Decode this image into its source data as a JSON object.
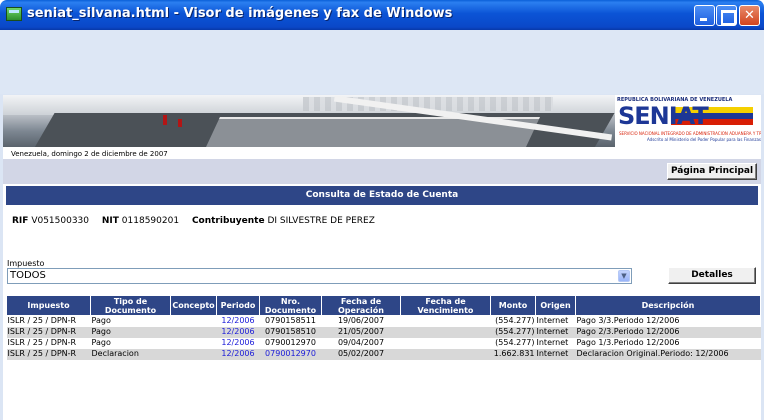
{
  "window": {
    "title": "seniat_silvana.html - Visor de imágenes y fax de Windows",
    "app_icon": "image-viewer-icon"
  },
  "banner": {
    "logo_top": "REPUBLICA BOLIVARIANA DE VENEZUELA",
    "logo_text": "SENIAT",
    "logo_sub": "SERVICIO NACIONAL INTEGRADO DE ADMINISTRACION ADUANERA Y TRIBUTARIA",
    "logo_sub2": "Adscrito al Ministerio del Poder Popular para las Finanzas",
    "date_line": "Venezuela, domingo 2 de diciembre de 2007"
  },
  "nav": {
    "home_button": "Página Principal"
  },
  "section": {
    "title": "Consulta de Estado de Cuenta"
  },
  "taxpayer": {
    "rif_label": "RIF",
    "rif_value": "V051500330",
    "nit_label": "NIT",
    "nit_value": "0118590201",
    "contrib_label": "Contribuyente",
    "contrib_value": "DI SILVESTRE DE PEREZ"
  },
  "filter": {
    "label": "Impuesto",
    "selected": "TODOS",
    "details_button": "Detalles"
  },
  "table": {
    "headers": [
      "Impuesto",
      "Tipo de Documento",
      "Concepto",
      "Periodo",
      "Nro. Documento",
      "Fecha de Operación",
      "Fecha de Vencimiento",
      "Monto",
      "Origen",
      "Descripción"
    ],
    "rows": [
      [
        "ISLR / 25 / DPN-R",
        "Pago",
        "",
        "12/2006",
        "0790158511",
        "19/06/2007",
        "",
        "(554.277)",
        "Internet",
        "Pago 3/3.Periodo 12/2006"
      ],
      [
        "ISLR / 25 / DPN-R",
        "Pago",
        "",
        "12/2006",
        "0790158510",
        "21/05/2007",
        "",
        "(554.277)",
        "Internet",
        "Pago 2/3.Periodo 12/2006"
      ],
      [
        "ISLR / 25 / DPN-R",
        "Pago",
        "",
        "12/2006",
        "0790012970",
        "09/04/2007",
        "",
        "(554.277)",
        "Internet",
        "Pago 1/3.Periodo 12/2006"
      ],
      [
        "ISLR / 25 / DPN-R",
        "Declaracion",
        "",
        "12/2006",
        "0790012970",
        "05/02/2007",
        "",
        "1.662.831",
        "Internet",
        "Declaracion Original.Periodo: 12/2006"
      ]
    ]
  },
  "colors": {
    "header_blue": "#2e4687",
    "link_blue": "#1a1ad8",
    "title_bar": "#0a48c8"
  }
}
